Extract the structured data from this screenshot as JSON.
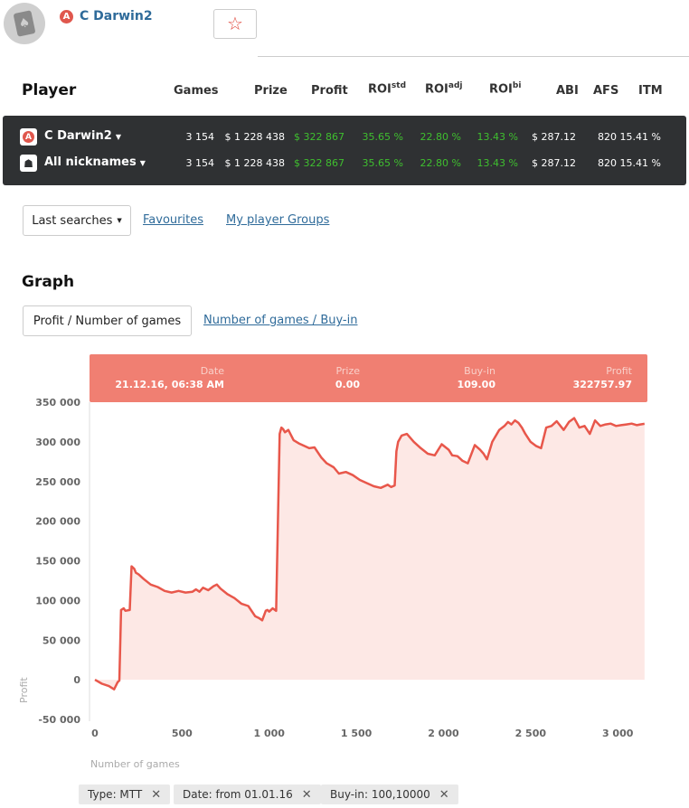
{
  "header": {
    "player_name": "C Darwin2",
    "favourite_icon": "star-outline-icon",
    "avatar_icon": "cards-icon"
  },
  "table": {
    "title": "Player",
    "headers": {
      "games": "Games",
      "prize": "Prize",
      "profit": "Profit",
      "roi_std": "ROI",
      "roi_std_sup": "std",
      "roi_adj": "ROI",
      "roi_adj_sup": "adj",
      "roi_bi": "ROI",
      "roi_bi_sup": "bi",
      "abi": "ABI",
      "afs": "AFS",
      "itm": "ITM"
    },
    "rows": [
      {
        "nick": "C Darwin2",
        "games": "3 154",
        "prize": "$ 1 228 438",
        "profit": "$ 322 867",
        "roi_std": "35.65 %",
        "roi_adj": "22.80 %",
        "roi_bi": "13.43 %",
        "abi": "$ 287.12",
        "afs": "820",
        "itm": "15.41 %"
      },
      {
        "nick": "All nicknames",
        "games": "3 154",
        "prize": "$ 1 228 438",
        "profit": "$ 322 867",
        "roi_std": "35.65 %",
        "roi_adj": "22.80 %",
        "roi_bi": "13.43 %",
        "abi": "$ 287.12",
        "afs": "820",
        "itm": "15.41 %"
      }
    ]
  },
  "nav": {
    "last_searches": "Last searches",
    "favourites": "Favourites",
    "player_groups": "My player Groups"
  },
  "graph": {
    "title": "Graph",
    "tab_active": "Profit / Number of games",
    "tab_other": "Number of games / Buy-in",
    "tooltip": {
      "date_label": "Date",
      "date_value": "21.12.16, 06:38 AM",
      "prize_label": "Prize",
      "prize_value": "0.00",
      "buyin_label": "Buy-in",
      "buyin_value": "109.00",
      "profit_label": "Profit",
      "profit_value": "322757.97"
    }
  },
  "chart_data": {
    "type": "area",
    "xlabel": "Number of games",
    "ylabel": "Profit",
    "xlim": [
      0,
      3154
    ],
    "ylim": [
      -50000,
      350000
    ],
    "x_ticks": [
      "0",
      "500",
      "1 000",
      "1 500",
      "2 000",
      "2 500",
      "3 000"
    ],
    "y_ticks": [
      "350 000",
      "300 000",
      "250 000",
      "200 000",
      "150 000",
      "100 000",
      "50 000",
      "0",
      "-50 000"
    ],
    "color": "#e8574b",
    "fill_color": "#fde8e5",
    "series": [
      {
        "x": [
          0,
          40,
          80,
          110,
          130,
          140,
          150,
          165,
          175,
          200,
          210,
          225,
          235,
          250,
          280,
          320,
          360,
          400,
          440,
          480,
          520,
          560,
          580,
          600,
          620,
          650,
          680,
          700,
          720,
          760,
          800,
          840,
          880,
          920,
          940,
          960,
          980,
          990,
          1000,
          1020,
          1040,
          1060,
          1070,
          1080,
          1090,
          1110,
          1140,
          1170,
          1200,
          1230,
          1260,
          1300,
          1330,
          1370,
          1400,
          1440,
          1480,
          1520,
          1560,
          1600,
          1640,
          1680,
          1700,
          1720,
          1730,
          1740,
          1760,
          1790,
          1830,
          1870,
          1910,
          1950,
          1990,
          2030,
          2050,
          2080,
          2110,
          2140,
          2180,
          2210,
          2230,
          2250,
          2280,
          2320,
          2350,
          2370,
          2390,
          2410,
          2430,
          2450,
          2470,
          2500,
          2530,
          2560,
          2590,
          2620,
          2650,
          2690,
          2720,
          2750,
          2780,
          2810,
          2840,
          2870,
          2900,
          2930,
          2960,
          2990,
          3020,
          3050,
          3080,
          3110,
          3130,
          3154
        ],
        "y": [
          0,
          -5000,
          -8000,
          -12000,
          -3000,
          -1000,
          88000,
          90000,
          87000,
          88000,
          143000,
          140000,
          135000,
          133000,
          127000,
          120000,
          117000,
          112000,
          110000,
          112000,
          110000,
          111000,
          114000,
          111000,
          116000,
          113000,
          118000,
          120000,
          115000,
          108000,
          103000,
          96000,
          93000,
          80000,
          78000,
          75000,
          87000,
          88000,
          86000,
          90000,
          87000,
          310000,
          318000,
          316000,
          312000,
          315000,
          302000,
          298000,
          295000,
          292000,
          293000,
          280000,
          273000,
          268000,
          260000,
          262000,
          258000,
          252000,
          248000,
          244000,
          242000,
          246000,
          243000,
          245000,
          288000,
          300000,
          308000,
          310000,
          300000,
          292000,
          285000,
          283000,
          297000,
          290000,
          283000,
          282000,
          276000,
          273000,
          296000,
          290000,
          285000,
          278000,
          300000,
          315000,
          320000,
          325000,
          322000,
          327000,
          324000,
          318000,
          310000,
          300000,
          295000,
          292000,
          318000,
          320000,
          326000,
          315000,
          325000,
          330000,
          318000,
          320000,
          310000,
          327000,
          320000,
          322000,
          323000,
          320000,
          321000,
          322000,
          323000,
          321000,
          322000,
          322758
        ]
      }
    ]
  },
  "filters": [
    {
      "label": "Type: MTT"
    },
    {
      "label": "Date: from 01.01.16"
    },
    {
      "label": "Buy-in: 100,10000"
    }
  ]
}
